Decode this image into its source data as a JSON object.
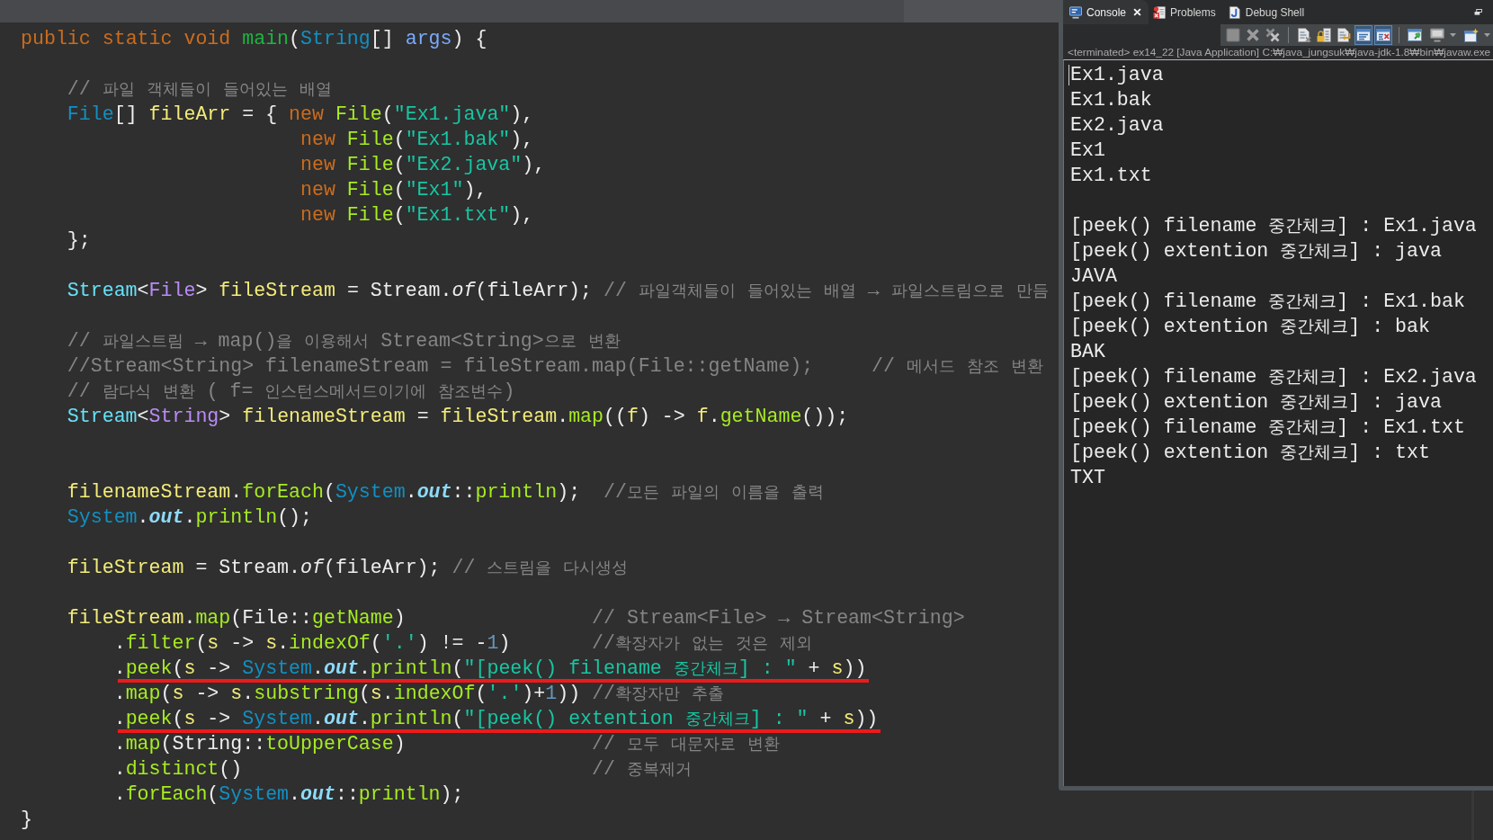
{
  "editor": {
    "lines": [
      {
        "kind": "code",
        "underlined": false,
        "tokens": [
          {
            "text": "public static void ",
            "kind": "keyword"
          },
          {
            "text": "main",
            "kind": "declaration"
          },
          {
            "text": "(",
            "kind": "plain"
          },
          {
            "text": "String",
            "kind": "type"
          },
          {
            "text": "[] ",
            "kind": "plain"
          },
          {
            "text": "args",
            "kind": "parameter"
          },
          {
            "text": ") {",
            "kind": "plain"
          }
        ]
      },
      {
        "kind": "blank"
      },
      {
        "kind": "code",
        "underlined": false,
        "tokens": [
          {
            "text": "    // 파일 객체들이 들어있는 배열",
            "kind": "comment"
          }
        ]
      },
      {
        "kind": "code",
        "underlined": false,
        "tokens": [
          {
            "text": "    File",
            "kind": "type"
          },
          {
            "text": "[] ",
            "kind": "plain"
          },
          {
            "text": "fileArr",
            "kind": "variable"
          },
          {
            "text": " = { ",
            "kind": "plain"
          },
          {
            "text": "new ",
            "kind": "keyword"
          },
          {
            "text": "File",
            "kind": "method"
          },
          {
            "text": "(",
            "kind": "plain"
          },
          {
            "text": "\"Ex1.java\"",
            "kind": "string"
          },
          {
            "text": "),",
            "kind": "plain"
          }
        ]
      },
      {
        "kind": "code",
        "underlined": false,
        "tokens": [
          {
            "text": "                        new ",
            "kind": "keyword"
          },
          {
            "text": "File",
            "kind": "method"
          },
          {
            "text": "(",
            "kind": "plain"
          },
          {
            "text": "\"Ex1.bak\"",
            "kind": "string"
          },
          {
            "text": "),",
            "kind": "plain"
          }
        ]
      },
      {
        "kind": "code",
        "underlined": false,
        "tokens": [
          {
            "text": "                        new ",
            "kind": "keyword"
          },
          {
            "text": "File",
            "kind": "method"
          },
          {
            "text": "(",
            "kind": "plain"
          },
          {
            "text": "\"Ex2.java\"",
            "kind": "string"
          },
          {
            "text": "),",
            "kind": "plain"
          }
        ]
      },
      {
        "kind": "code",
        "underlined": false,
        "tokens": [
          {
            "text": "                        new ",
            "kind": "keyword"
          },
          {
            "text": "File",
            "kind": "method"
          },
          {
            "text": "(",
            "kind": "plain"
          },
          {
            "text": "\"Ex1\"",
            "kind": "string"
          },
          {
            "text": "),",
            "kind": "plain"
          }
        ]
      },
      {
        "kind": "code",
        "underlined": false,
        "tokens": [
          {
            "text": "                        new ",
            "kind": "keyword"
          },
          {
            "text": "File",
            "kind": "method"
          },
          {
            "text": "(",
            "kind": "plain"
          },
          {
            "text": "\"Ex1.txt\"",
            "kind": "string"
          },
          {
            "text": "),",
            "kind": "plain"
          }
        ]
      },
      {
        "kind": "code",
        "underlined": false,
        "tokens": [
          {
            "text": "    };",
            "kind": "plain"
          }
        ]
      },
      {
        "kind": "blank"
      },
      {
        "kind": "code",
        "underlined": false,
        "tokens": [
          {
            "text": "    Stream",
            "kind": "interface"
          },
          {
            "text": "<",
            "kind": "plain"
          },
          {
            "text": "File",
            "kind": "argument"
          },
          {
            "text": "> ",
            "kind": "plain"
          },
          {
            "text": "fileStream",
            "kind": "variable"
          },
          {
            "text": " = Stream.",
            "kind": "plain"
          },
          {
            "text": "of",
            "kind": "static"
          },
          {
            "text": "(fileArr); ",
            "kind": "plain"
          },
          {
            "text": "// 파일객체들이 들어있는 배열 → 파일스트림으로 만듬",
            "kind": "comment"
          }
        ]
      },
      {
        "kind": "blank"
      },
      {
        "kind": "code",
        "underlined": false,
        "tokens": [
          {
            "text": "    // 파일스트림 → map()을 이용해서 Stream<String>으로 변환",
            "kind": "comment"
          }
        ]
      },
      {
        "kind": "code",
        "underlined": false,
        "tokens": [
          {
            "text": "    //Stream<String> filenameStream = fileStream.map(File::getName);     // 메서드 참조 변환",
            "kind": "comment"
          }
        ]
      },
      {
        "kind": "code",
        "underlined": false,
        "tokens": [
          {
            "text": "    // 람다식 변환 ( f= 인스턴스메서드이기에 참조변수)",
            "kind": "comment"
          }
        ]
      },
      {
        "kind": "code",
        "underlined": false,
        "tokens": [
          {
            "text": "    Stream",
            "kind": "interface"
          },
          {
            "text": "<",
            "kind": "plain"
          },
          {
            "text": "String",
            "kind": "argument"
          },
          {
            "text": "> ",
            "kind": "plain"
          },
          {
            "text": "filenameStream",
            "kind": "variable"
          },
          {
            "text": " = ",
            "kind": "plain"
          },
          {
            "text": "fileStream",
            "kind": "variable"
          },
          {
            "text": ".",
            "kind": "plain"
          },
          {
            "text": "map",
            "kind": "method"
          },
          {
            "text": "((",
            "kind": "plain"
          },
          {
            "text": "f",
            "kind": "variable"
          },
          {
            "text": ") -> ",
            "kind": "plain"
          },
          {
            "text": "f",
            "kind": "variable"
          },
          {
            "text": ".",
            "kind": "plain"
          },
          {
            "text": "getName",
            "kind": "method"
          },
          {
            "text": "());",
            "kind": "plain"
          }
        ]
      },
      {
        "kind": "blank"
      },
      {
        "kind": "blank"
      },
      {
        "kind": "code",
        "underlined": false,
        "tokens": [
          {
            "text": "    filenameStream",
            "kind": "variable"
          },
          {
            "text": ".",
            "kind": "plain"
          },
          {
            "text": "forEach",
            "kind": "method"
          },
          {
            "text": "(",
            "kind": "plain"
          },
          {
            "text": "System",
            "kind": "type"
          },
          {
            "text": ".",
            "kind": "plain"
          },
          {
            "text": "out",
            "kind": "field"
          },
          {
            "text": "::",
            "kind": "plain"
          },
          {
            "text": "println",
            "kind": "method"
          },
          {
            "text": ");  ",
            "kind": "plain"
          },
          {
            "text": "//모든 파일의 이름을 출력",
            "kind": "comment"
          }
        ]
      },
      {
        "kind": "code",
        "underlined": false,
        "tokens": [
          {
            "text": "    System",
            "kind": "type"
          },
          {
            "text": ".",
            "kind": "plain"
          },
          {
            "text": "out",
            "kind": "field"
          },
          {
            "text": ".",
            "kind": "plain"
          },
          {
            "text": "println",
            "kind": "method"
          },
          {
            "text": "();",
            "kind": "plain"
          }
        ]
      },
      {
        "kind": "blank"
      },
      {
        "kind": "code",
        "underlined": false,
        "tokens": [
          {
            "text": "    fileStream",
            "kind": "variable"
          },
          {
            "text": " = Stream.",
            "kind": "plain"
          },
          {
            "text": "of",
            "kind": "static"
          },
          {
            "text": "(fileArr); ",
            "kind": "plain"
          },
          {
            "text": "// 스트림을 다시생성",
            "kind": "comment"
          }
        ]
      },
      {
        "kind": "blank"
      },
      {
        "kind": "code",
        "underlined": false,
        "tokens": [
          {
            "text": "    fileStream",
            "kind": "variable"
          },
          {
            "text": ".",
            "kind": "plain"
          },
          {
            "text": "map",
            "kind": "method"
          },
          {
            "text": "(File::",
            "kind": "plain"
          },
          {
            "text": "getName",
            "kind": "method"
          },
          {
            "text": ")",
            "kind": "plain"
          },
          {
            "text": "                // Stream<File> → Stream<String>",
            "kind": "comment"
          }
        ]
      },
      {
        "kind": "code",
        "underlined": false,
        "tokens": [
          {
            "text": "        .filter",
            "kind": "call"
          },
          {
            "text": "(",
            "kind": "plain"
          },
          {
            "text": "s",
            "kind": "variable"
          },
          {
            "text": " -> ",
            "kind": "plain"
          },
          {
            "text": "s",
            "kind": "variable"
          },
          {
            "text": ".",
            "kind": "plain"
          },
          {
            "text": "indexOf",
            "kind": "method"
          },
          {
            "text": "(",
            "kind": "plain"
          },
          {
            "text": "'.'",
            "kind": "string"
          },
          {
            "text": ") != -",
            "kind": "plain"
          },
          {
            "text": "1",
            "kind": "number"
          },
          {
            "text": ")",
            "kind": "plain"
          },
          {
            "text": "       //확장자가 없는 것은 제외",
            "kind": "comment"
          }
        ]
      },
      {
        "kind": "code",
        "underlined": true,
        "tokens": [
          {
            "text": "        .peek",
            "kind": "call"
          },
          {
            "text": "(",
            "kind": "plain"
          },
          {
            "text": "s",
            "kind": "variable"
          },
          {
            "text": " -> ",
            "kind": "plain"
          },
          {
            "text": "System",
            "kind": "type"
          },
          {
            "text": ".",
            "kind": "plain"
          },
          {
            "text": "out",
            "kind": "field"
          },
          {
            "text": ".",
            "kind": "plain"
          },
          {
            "text": "println",
            "kind": "method"
          },
          {
            "text": "(",
            "kind": "plain"
          },
          {
            "text": "\"[peek() filename 중간체크] : \"",
            "kind": "string"
          },
          {
            "text": " + ",
            "kind": "plain"
          },
          {
            "text": "s",
            "kind": "variable"
          },
          {
            "text": "))",
            "kind": "plain"
          }
        ]
      },
      {
        "kind": "code",
        "underlined": false,
        "tokens": [
          {
            "text": "        .map",
            "kind": "call"
          },
          {
            "text": "(",
            "kind": "plain"
          },
          {
            "text": "s",
            "kind": "variable"
          },
          {
            "text": " -> ",
            "kind": "plain"
          },
          {
            "text": "s",
            "kind": "variable"
          },
          {
            "text": ".",
            "kind": "plain"
          },
          {
            "text": "substring",
            "kind": "method"
          },
          {
            "text": "(",
            "kind": "plain"
          },
          {
            "text": "s",
            "kind": "variable"
          },
          {
            "text": ".",
            "kind": "plain"
          },
          {
            "text": "indexOf",
            "kind": "method"
          },
          {
            "text": "(",
            "kind": "plain"
          },
          {
            "text": "'.'",
            "kind": "string"
          },
          {
            "text": ")+",
            "kind": "plain"
          },
          {
            "text": "1",
            "kind": "number"
          },
          {
            "text": ")) ",
            "kind": "plain"
          },
          {
            "text": "//확장자만 추출",
            "kind": "comment"
          }
        ]
      },
      {
        "kind": "code",
        "underlined": true,
        "tokens": [
          {
            "text": "        .peek",
            "kind": "call"
          },
          {
            "text": "(",
            "kind": "plain"
          },
          {
            "text": "s",
            "kind": "variable"
          },
          {
            "text": " -> ",
            "kind": "plain"
          },
          {
            "text": "System",
            "kind": "type"
          },
          {
            "text": ".",
            "kind": "plain"
          },
          {
            "text": "out",
            "kind": "field"
          },
          {
            "text": ".",
            "kind": "plain"
          },
          {
            "text": "println",
            "kind": "method"
          },
          {
            "text": "(",
            "kind": "plain"
          },
          {
            "text": "\"[peek() extention 중간체크] : \"",
            "kind": "string"
          },
          {
            "text": " + ",
            "kind": "plain"
          },
          {
            "text": "s",
            "kind": "variable"
          },
          {
            "text": "))",
            "kind": "plain"
          }
        ]
      },
      {
        "kind": "code",
        "underlined": false,
        "tokens": [
          {
            "text": "        .map",
            "kind": "call"
          },
          {
            "text": "(String::",
            "kind": "plain"
          },
          {
            "text": "toUpperCase",
            "kind": "method"
          },
          {
            "text": ")",
            "kind": "plain"
          },
          {
            "text": "                // 모두 대문자로 변환",
            "kind": "comment"
          }
        ]
      },
      {
        "kind": "code",
        "underlined": false,
        "tokens": [
          {
            "text": "        .distinct",
            "kind": "call"
          },
          {
            "text": "()",
            "kind": "plain"
          },
          {
            "text": "                              // 중복제거",
            "kind": "comment"
          }
        ]
      },
      {
        "kind": "code",
        "underlined": false,
        "tokens": [
          {
            "text": "        .forEach",
            "kind": "call"
          },
          {
            "text": "(",
            "kind": "plain"
          },
          {
            "text": "System",
            "kind": "type"
          },
          {
            "text": ".",
            "kind": "plain"
          },
          {
            "text": "out",
            "kind": "field"
          },
          {
            "text": "::",
            "kind": "plain"
          },
          {
            "text": "println",
            "kind": "method"
          },
          {
            "text": ");",
            "kind": "plain"
          }
        ]
      },
      {
        "kind": "code",
        "underlined": false,
        "tokens": [
          {
            "text": "}",
            "kind": "plain"
          }
        ]
      }
    ]
  },
  "console_view": {
    "tabs": [
      {
        "label": "Console",
        "kind": "console",
        "selected": true
      },
      {
        "label": "Problems",
        "kind": "problems",
        "selected": false
      },
      {
        "label": "Debug Shell",
        "kind": "shell",
        "selected": false
      }
    ],
    "toolbar": {
      "groups": [
        {
          "buttons": [
            {
              "kind": "terminate",
              "disabled": true,
              "pressed": false,
              "dropdown": false
            },
            {
              "kind": "remove",
              "disabled": false,
              "pressed": false,
              "dropdown": false
            },
            {
              "kind": "purge",
              "disabled": false,
              "pressed": false,
              "dropdown": false
            }
          ]
        },
        {
          "buttons": [
            {
              "kind": "clear",
              "disabled": false,
              "pressed": false,
              "dropdown": false
            },
            {
              "kind": "scrolllock",
              "disabled": false,
              "pressed": false,
              "dropdown": false
            },
            {
              "kind": "wordwrap",
              "disabled": false,
              "pressed": false,
              "dropdown": false
            },
            {
              "kind": "stdout",
              "disabled": false,
              "pressed": true,
              "dropdown": false
            },
            {
              "kind": "stderr",
              "disabled": false,
              "pressed": true,
              "dropdown": false
            }
          ]
        },
        {
          "buttons": [
            {
              "kind": "pin",
              "disabled": false,
              "pressed": false,
              "dropdown": false
            },
            {
              "kind": "display",
              "disabled": false,
              "pressed": false,
              "dropdown": true
            },
            {
              "kind": "open",
              "disabled": false,
              "pressed": false,
              "dropdown": true
            }
          ]
        }
      ]
    },
    "status": "<terminated> ex14_22 [Java Application] C:₩java_jungsuk₩java-jdk-1.8₩bin₩javaw.exe",
    "output": {
      "blocks": [
        {
          "lines": [
            "Ex1.java",
            "Ex1.bak",
            "Ex2.java",
            "Ex1",
            "Ex1.txt"
          ]
        },
        {
          "lines": [
            "[peek() filename 중간체크] : Ex1.java",
            "[peek() extention 중간체크] : java",
            "JAVA",
            "[peek() filename 중간체크] : Ex1.bak",
            "[peek() extention 중간체크] : bak",
            "BAK",
            "[peek() filename 중간체크] : Ex2.java",
            "[peek() extention 중간체크] : java",
            "[peek() filename 중간체크] : Ex1.txt",
            "[peek() extention 중간체크] : txt",
            "TXT"
          ]
        }
      ]
    }
  }
}
